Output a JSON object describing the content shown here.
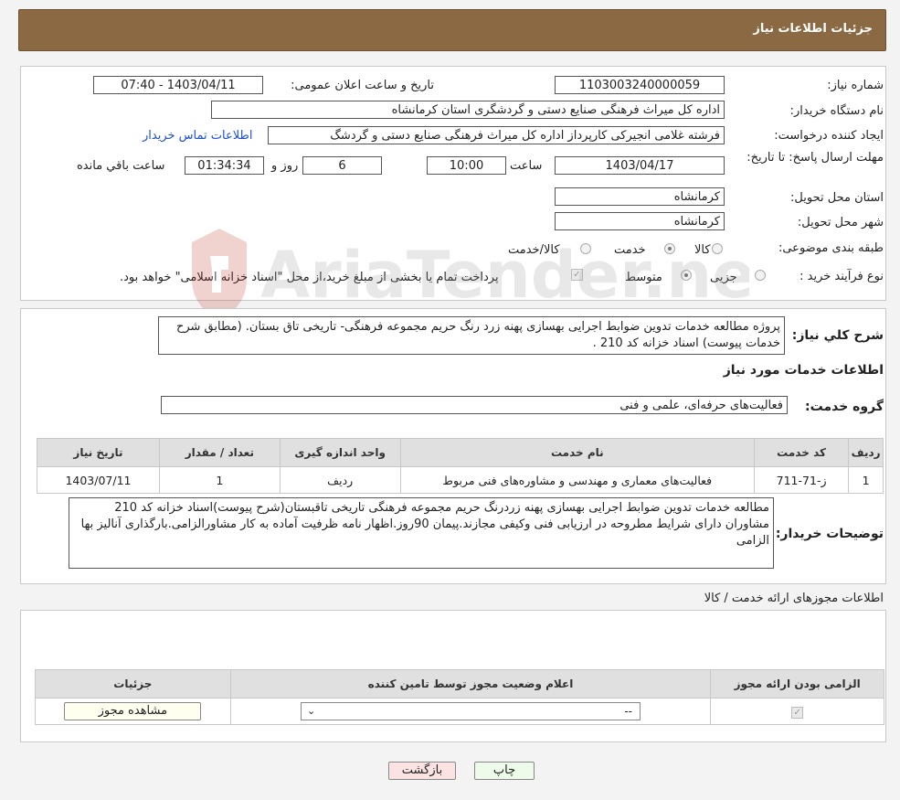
{
  "header": {
    "title": "جزئیات اطلاعات نیاز"
  },
  "info": {
    "need_number_label": "شماره نیاز:",
    "need_number": "1103003240000059",
    "announce_label": "تاریخ و ساعت اعلان عمومی:",
    "announce_value": "1403/04/11 - 07:40",
    "buyer_org_label": "نام دستگاه خریدار:",
    "buyer_org": "اداره کل میراث فرهنگی  صنایع دستی و گردشگری استان کرمانشاه",
    "creator_label": "ایجاد کننده درخواست:",
    "creator": "فرشته غلامی انجیرکی کارپرداز اداره کل میراث فرهنگی  صنایع دستی و گردشگ",
    "contact_link": "اطلاعات تماس خریدار",
    "deadline_label": "مهلت ارسال پاسخ: تا تاریخ:",
    "deadline_date": "1403/04/17",
    "time_label": "ساعت",
    "deadline_time": "10:00",
    "days": "6",
    "days_label": "روز و",
    "remaining": "01:34:34",
    "remaining_label": "ساعت باقي مانده",
    "province_label": "استان محل تحویل:",
    "province": "کرمانشاه",
    "city_label": "شهر محل تحویل:",
    "city": "کرمانشاه",
    "category_label": "طبقه بندی موضوعی:",
    "category_options": [
      "کالا",
      "خدمت",
      "کالا/خدمت"
    ],
    "category_selected": "خدمت",
    "process_label": "نوع فرآیند خرید :",
    "process_options": [
      "جزیی",
      "متوسط"
    ],
    "process_selected": "متوسط",
    "payment_note": "پرداخت تمام یا بخشی از مبلغ خرید،از محل \"اسناد خزانه اسلامی\" خواهد بود."
  },
  "summary": {
    "label": "شرح کلي نياز:",
    "text": "پروژه مطالعه خدمات تدوین ضوابط اجرایی بهسازی پهنه زرد رنگ حریم مجموعه فرهنگی- تاریخی تاق بستان. (مطابق شرح خدمات پیوست) اسناد خزانه کد 210 ."
  },
  "services": {
    "section_title": "اطلاعات خدمات مورد نیاز",
    "group_label": "گروه خدمت:",
    "group_value": "فعالیت‌های حرفه‌ای، علمی و فنی",
    "columns": [
      "ردیف",
      "کد خدمت",
      "نام خدمت",
      "واحد اندازه گیری",
      "تعداد / مقدار",
      "تاریخ نیاز"
    ],
    "rows": [
      [
        "1",
        "ز-71-711",
        "فعالیت‌های معماری و مهندسی و مشاوره‌های فنی مربوط",
        "ردیف",
        "1",
        "1403/07/11"
      ]
    ]
  },
  "buyer_notes": {
    "label": "توضیحات خریدار:",
    "text": "مطالعه خدمات تدوین ضوابط اجرایی بهسازی پهنه زردرنگ حریم مجموعه فرهنگی تاریخی تاقبستان(شرح پیوست)اسناد خزانه کد 210 مشاوران دارای شرایط مطروحه در ارزیابی فنی وکیفی مجازند.پیمان 90روز.اظهار نامه ظرفیت آماده به کار مشاورالزامی.بارگذاری آنالیز بها الزامی"
  },
  "licenses": {
    "section_title": "اطلاعات مجوزهای ارائه خدمت / کالا",
    "columns": [
      "الزامی بودن ارائه مجوز",
      "اعلام وضعیت مجوز توسط تامین کننده",
      "جزئیات"
    ],
    "select_value": "--",
    "view_button": "مشاهده مجوز"
  },
  "buttons": {
    "print": "چاپ",
    "back": "بازگشت"
  },
  "watermark": "AriaTender.neT"
}
